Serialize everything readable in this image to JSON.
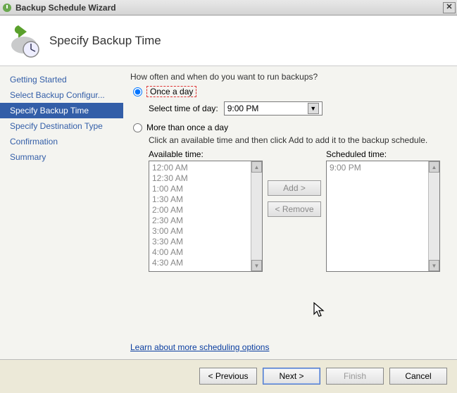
{
  "window": {
    "title": "Backup Schedule Wizard"
  },
  "header": {
    "title": "Specify Backup Time"
  },
  "sidebar": {
    "steps": [
      {
        "label": "Getting Started",
        "active": false
      },
      {
        "label": "Select Backup Configur...",
        "active": false
      },
      {
        "label": "Specify Backup Time",
        "active": true
      },
      {
        "label": "Specify Destination Type",
        "active": false
      },
      {
        "label": "Confirmation",
        "active": false
      },
      {
        "label": "Summary",
        "active": false
      }
    ]
  },
  "content": {
    "question": "How often and when do you want to run backups?",
    "option_once": "Once a day",
    "select_time_label": "Select time of day:",
    "select_time_value": "9:00 PM",
    "option_multi": "More than once a day",
    "multi_hint": "Click an available time and then click Add to add it to the backup schedule.",
    "available_label": "Available time:",
    "scheduled_label": "Scheduled time:",
    "available_times": [
      "12:00 AM",
      "12:30 AM",
      "1:00 AM",
      "1:30 AM",
      "2:00 AM",
      "2:30 AM",
      "3:00 AM",
      "3:30 AM",
      "4:00 AM",
      "4:30 AM"
    ],
    "scheduled_times": [
      "9:00 PM"
    ],
    "btn_add": "Add >",
    "btn_remove": "< Remove",
    "link_more": "Learn about more scheduling options"
  },
  "footer": {
    "previous": "< Previous",
    "next": "Next >",
    "finish": "Finish",
    "cancel": "Cancel"
  }
}
